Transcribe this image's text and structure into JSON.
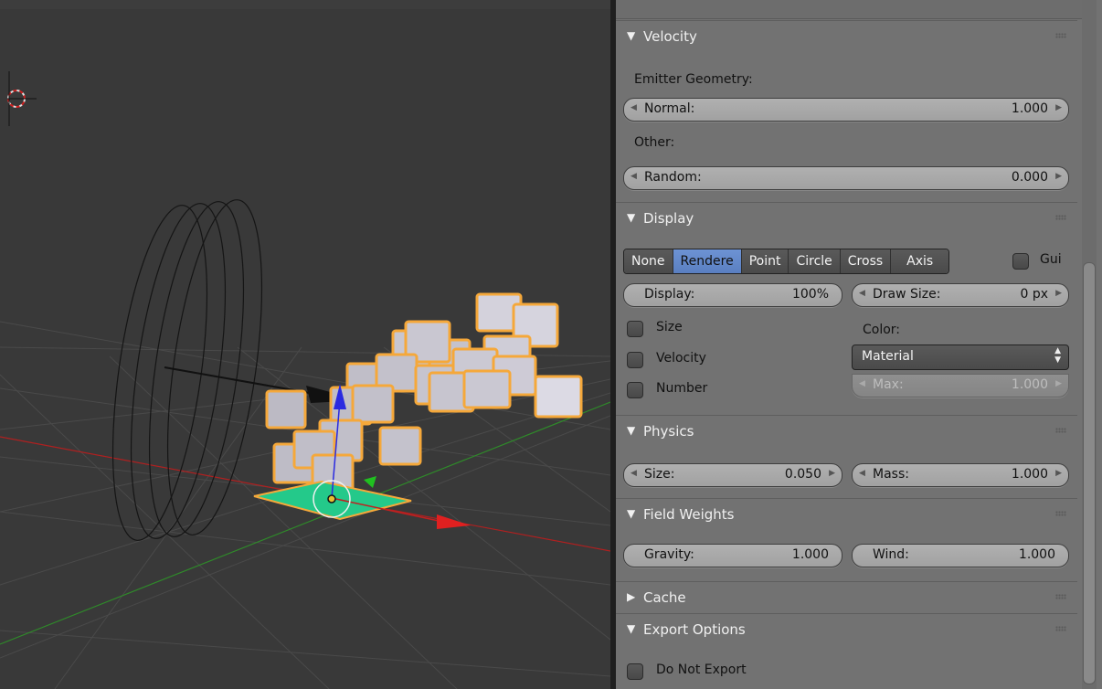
{
  "velocity": {
    "title": "Velocity",
    "emitter_geometry_label": "Emitter Geometry:",
    "normal": {
      "label": "Normal:",
      "value": "1.000"
    },
    "other_label": "Other:",
    "random": {
      "label": "Random:",
      "value": "0.000"
    }
  },
  "display": {
    "title": "Display",
    "modes": [
      "None",
      "Rendere",
      "Point",
      "Circle",
      "Cross",
      "Axis"
    ],
    "active_mode": "Rendere",
    "gui_label": "Gui",
    "display_field": {
      "label": "Display:",
      "value": "100%"
    },
    "draw_size": {
      "label": "Draw Size:",
      "value": "0 px"
    },
    "size_label": "Size",
    "velocity_label": "Velocity",
    "number_label": "Number",
    "color_label": "Color:",
    "color_value": "Material",
    "max": {
      "label": "Max:",
      "value": "1.000"
    }
  },
  "physics": {
    "title": "Physics",
    "size": {
      "label": "Size:",
      "value": "0.050"
    },
    "mass": {
      "label": "Mass:",
      "value": "1.000"
    }
  },
  "field_weights": {
    "title": "Field Weights",
    "gravity": {
      "label": "Gravity:",
      "value": "1.000"
    },
    "wind": {
      "label": "Wind:",
      "value": "1.000"
    }
  },
  "cache": {
    "title": "Cache"
  },
  "export_options": {
    "title": "Export Options",
    "do_not_export_label": "Do Not Export"
  },
  "icons": {
    "expanded": "triangle-down-icon",
    "collapsed": "triangle-right-icon",
    "grip": "drag-grip-icon"
  },
  "colors": {
    "selection_outline": "#f5a83a",
    "active_toggle": "#5f86c8",
    "x_axis": "#c02020",
    "y_axis": "#3a8a2a",
    "emitter_plane": "#24c98a"
  }
}
